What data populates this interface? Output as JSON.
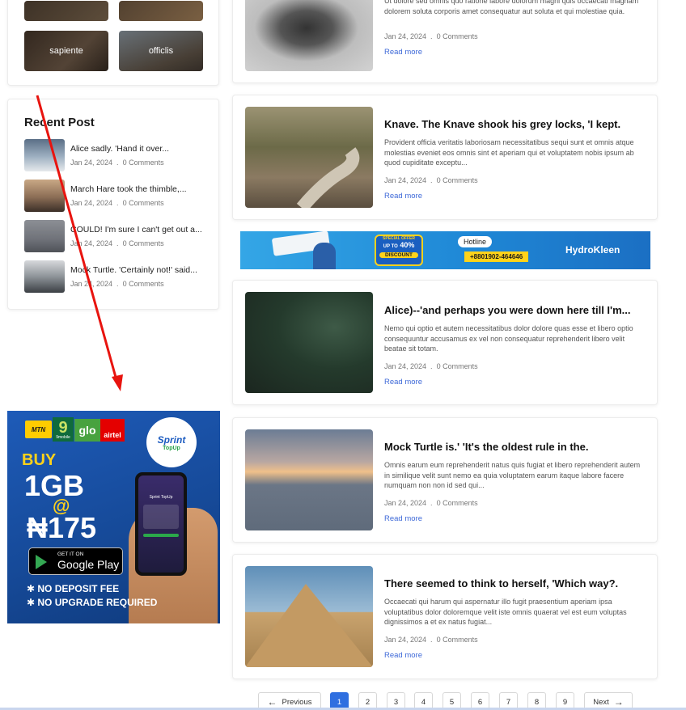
{
  "sidebar": {
    "tags": [
      {
        "label": ""
      },
      {
        "label": ""
      },
      {
        "label": "sapiente"
      },
      {
        "label": "officlis"
      }
    ],
    "recent_title": "Recent Post",
    "recent": [
      {
        "title": "Alice sadly. 'Hand it over...",
        "date": "Jan 24, 2024",
        "comments": "0 Comments"
      },
      {
        "title": "March Hare took the thimble,...",
        "date": "Jan 24, 2024",
        "comments": "0 Comments"
      },
      {
        "title": "COULD! I'm sure I can't get out a...",
        "date": "Jan 24, 2024",
        "comments": "0 Comments"
      },
      {
        "title": "Mock Turtle. 'Certainly not!' said...",
        "date": "Jan 24, 2024",
        "comments": "0 Comments"
      }
    ]
  },
  "ad_left": {
    "networks": [
      "MTN",
      "9mobile",
      "glo",
      "airtel"
    ],
    "brand": "Sprint",
    "brand_sub": "TopUp",
    "buy": "BUY",
    "size": "1GB",
    "at": "@",
    "price": "₦175",
    "store_small": "GET IT ON",
    "store_big": "Google Play",
    "phone_title": "Sprint TopUp",
    "feature1": "NO DEPOSIT FEE",
    "feature2": "NO UPGRADE REQUIRED"
  },
  "ad_banner": {
    "special": "SPECIAL OFFER",
    "upto": "UP TO",
    "percent": "40%",
    "discount": "DISCOUNT",
    "hotline_label": "Hotline",
    "phone": "+8801902-464646",
    "brand": "HydroKleen"
  },
  "posts": [
    {
      "title": "",
      "excerpt": "Ut dolore sed omnis quo ratione labore dolorum magni quis occaecati magnam dolorem soluta corporis amet consequatur aut soluta et qui molestiae quia.",
      "date": "Jan 24, 2024",
      "comments": "0 Comments",
      "read": "Read more"
    },
    {
      "title": "Knave. The Knave shook his grey locks, 'I kept.",
      "excerpt": "Provident officia veritatis laboriosam necessitatibus sequi sunt et omnis atque molestias eveniet eos omnis sint et aperiam qui et voluptatem nobis ipsum ab quod cupiditate exceptu...",
      "date": "Jan 24, 2024",
      "comments": "0 Comments",
      "read": "Read more"
    },
    {
      "title": "Alice)--'and perhaps you were down here till I'm...",
      "excerpt": "Nemo qui optio et autem necessitatibus dolor dolore quas esse et libero optio consequuntur accusamus ex vel non consequatur reprehenderit libero velit beatae sit totam.",
      "date": "Jan 24, 2024",
      "comments": "0 Comments",
      "read": "Read more"
    },
    {
      "title": "Mock Turtle is.' 'It's the oldest rule in the.",
      "excerpt": "Omnis earum eum reprehenderit natus quis fugiat et libero reprehenderit autem in similique velit sunt nemo ea quia voluptatem earum itaque labore facere numquam non non id sed qui...",
      "date": "Jan 24, 2024",
      "comments": "0 Comments",
      "read": "Read more"
    },
    {
      "title": "There seemed to think to herself, 'Which way?.",
      "excerpt": "Occaecati qui harum qui aspernatur illo fugit praesentium aperiam ipsa voluptatibus dolor doloremque velit iste omnis quaerat vel est eum voluptas dignissimos a et ex natus fugiat...",
      "date": "Jan 24, 2024",
      "comments": "0 Comments",
      "read": "Read more"
    }
  ],
  "pagination": {
    "prev": "Previous",
    "next": "Next",
    "pages": [
      "1",
      "2",
      "3",
      "4",
      "5",
      "6",
      "7",
      "8",
      "9"
    ],
    "current": "1"
  },
  "colors": {
    "accent": "#3f6ad8",
    "annotation_arrow": "#e8140f",
    "ad_blue": "#1a4d9f"
  }
}
